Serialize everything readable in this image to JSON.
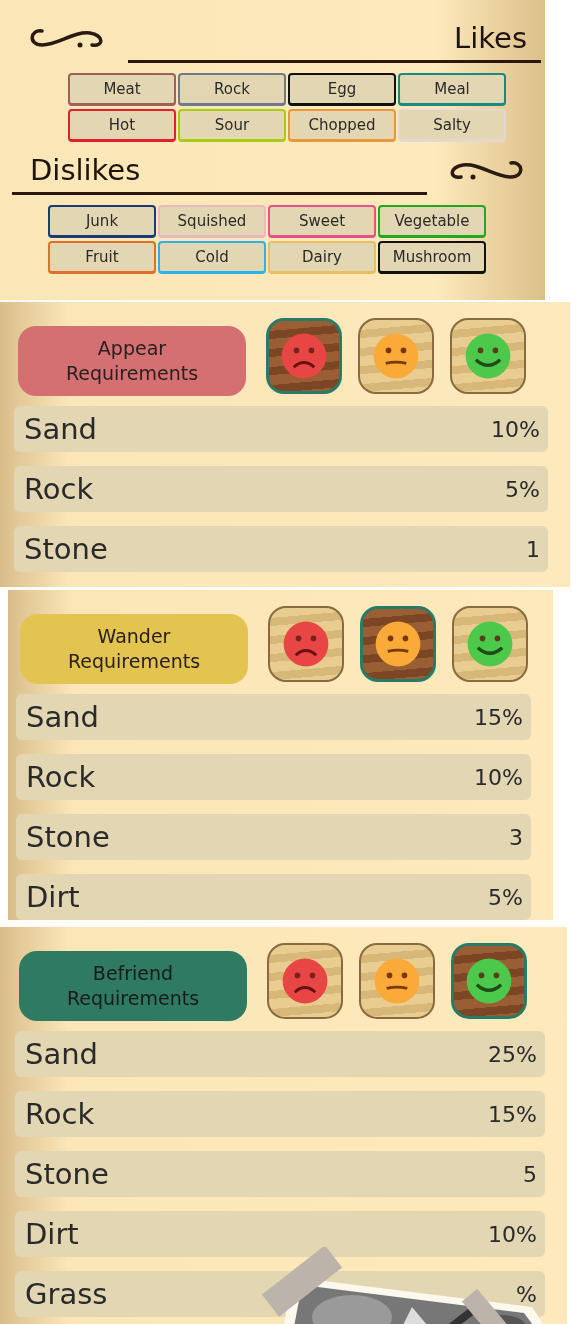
{
  "likes": {
    "title": "Likes",
    "tags": [
      {
        "label": "Meat",
        "color": "#a0605a"
      },
      {
        "label": "Rock",
        "color": "#70788a"
      },
      {
        "label": "Egg",
        "color": "#111111"
      },
      {
        "label": "Meal",
        "color": "#1a8a80"
      },
      {
        "label": "Hot",
        "color": "#e02030"
      },
      {
        "label": "Sour",
        "color": "#a8cc10"
      },
      {
        "label": "Chopped",
        "color": "#e8983a"
      },
      {
        "label": "Salty",
        "color": "#e2d8d0"
      }
    ]
  },
  "dislikes": {
    "title": "Dislikes",
    "tags": [
      {
        "label": "Junk",
        "color": "#1a3a78"
      },
      {
        "label": "Squished",
        "color": "#eab8c0"
      },
      {
        "label": "Sweet",
        "color": "#e8508a"
      },
      {
        "label": "Vegetable",
        "color": "#20a820"
      },
      {
        "label": "Fruit",
        "color": "#e07028"
      },
      {
        "label": "Cold",
        "color": "#30b0e8"
      },
      {
        "label": "Dairy",
        "color": "#e8c060"
      },
      {
        "label": "Mushroom",
        "color": "#111111"
      }
    ]
  },
  "requirements": [
    {
      "title": "Appear Requirements",
      "color": "#d47072",
      "faces": [
        {
          "kind": "sad",
          "selected": true
        },
        {
          "kind": "neutral",
          "selected": false
        },
        {
          "kind": "happy",
          "selected": false
        }
      ],
      "rows": [
        {
          "name": "Sand",
          "value": "10%"
        },
        {
          "name": "Rock",
          "value": "5%"
        },
        {
          "name": "Stone",
          "value": "1"
        }
      ]
    },
    {
      "title": "Wander Requirements",
      "color": "#e4c450",
      "faces": [
        {
          "kind": "sad",
          "selected": false
        },
        {
          "kind": "neutral",
          "selected": true
        },
        {
          "kind": "happy",
          "selected": false
        }
      ],
      "rows": [
        {
          "name": "Sand",
          "value": "15%"
        },
        {
          "name": "Rock",
          "value": "10%"
        },
        {
          "name": "Stone",
          "value": "3"
        },
        {
          "name": "Dirt",
          "value": "5%"
        }
      ]
    },
    {
      "title": "Befriend Requirements",
      "color": "#2f7a62",
      "faces": [
        {
          "kind": "sad",
          "selected": false
        },
        {
          "kind": "neutral",
          "selected": false
        },
        {
          "kind": "happy",
          "selected": true
        }
      ],
      "rows": [
        {
          "name": "Sand",
          "value": "25%"
        },
        {
          "name": "Rock",
          "value": "15%"
        },
        {
          "name": "Stone",
          "value": "5"
        },
        {
          "name": "Dirt",
          "value": "10%"
        },
        {
          "name": "Grass",
          "value": "%"
        }
      ],
      "photo": {
        "kind": "picture"
      }
    }
  ]
}
